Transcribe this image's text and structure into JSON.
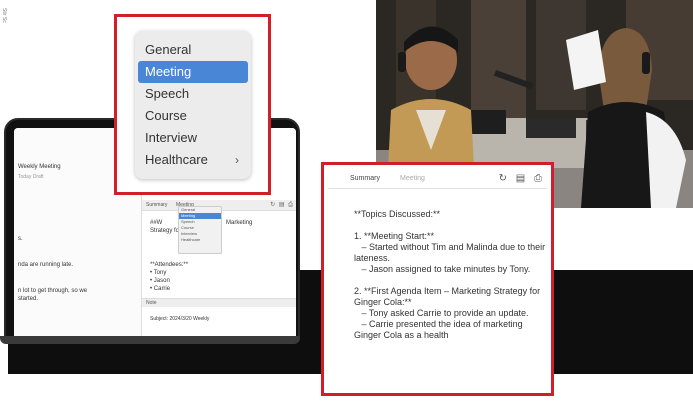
{
  "edge_text": "Stir Sc",
  "menu": {
    "items": [
      {
        "label": "General",
        "selected": false
      },
      {
        "label": "Meeting",
        "selected": true
      },
      {
        "label": "Speech",
        "selected": false
      },
      {
        "label": "Course",
        "selected": false
      },
      {
        "label": "Interview",
        "selected": false
      },
      {
        "label": "Healthcare",
        "selected": false,
        "submenu": true
      }
    ],
    "chevron": "›"
  },
  "laptop": {
    "doc_title": "Weekly Meeting",
    "doc_meta": "Today  Draft",
    "doc_lines": [
      "s.",
      "nda are running late.",
      "n lot to get through, so we",
      "started."
    ],
    "mini_tabs": [
      "Summary",
      "Meeting"
    ],
    "mini_icons": "↻ ▤ ⎙",
    "mini_menu": [
      "General",
      "Meeting",
      "Speech",
      "Course",
      "Interview",
      "Healthcare"
    ],
    "mini_text_lines": [
      "##W",
      "Strategy for Ginger Cola",
      "",
      "**Attendees:**",
      "• Tony",
      "• Jason",
      "• Carrie"
    ],
    "mini_marketing": "Marketing",
    "mini_bottom_label": "Note",
    "mini_footer": "Subject: 2024/3/20 Weekly"
  },
  "summary": {
    "tabs": [
      "Summary",
      "Meeting"
    ],
    "icons": "↻ ▤ ⎙",
    "paragraphs": [
      "**Topics Discussed:**",
      "1. **Meeting Start:**\n   – Started without Tim and Malinda due to their lateness.\n   – Jason assigned to take minutes by Tony.",
      "2. **First Agenda Item – Marketing Strategy for Ginger Cola:**\n   – Tony asked Carrie to provide an update.\n   – Carrie presented the idea of marketing Ginger Cola as a health"
    ]
  },
  "colors": {
    "callout_border": "#d11f2a",
    "menu_selection": "#4a86d6",
    "dark_band": "#0e0e0e"
  }
}
